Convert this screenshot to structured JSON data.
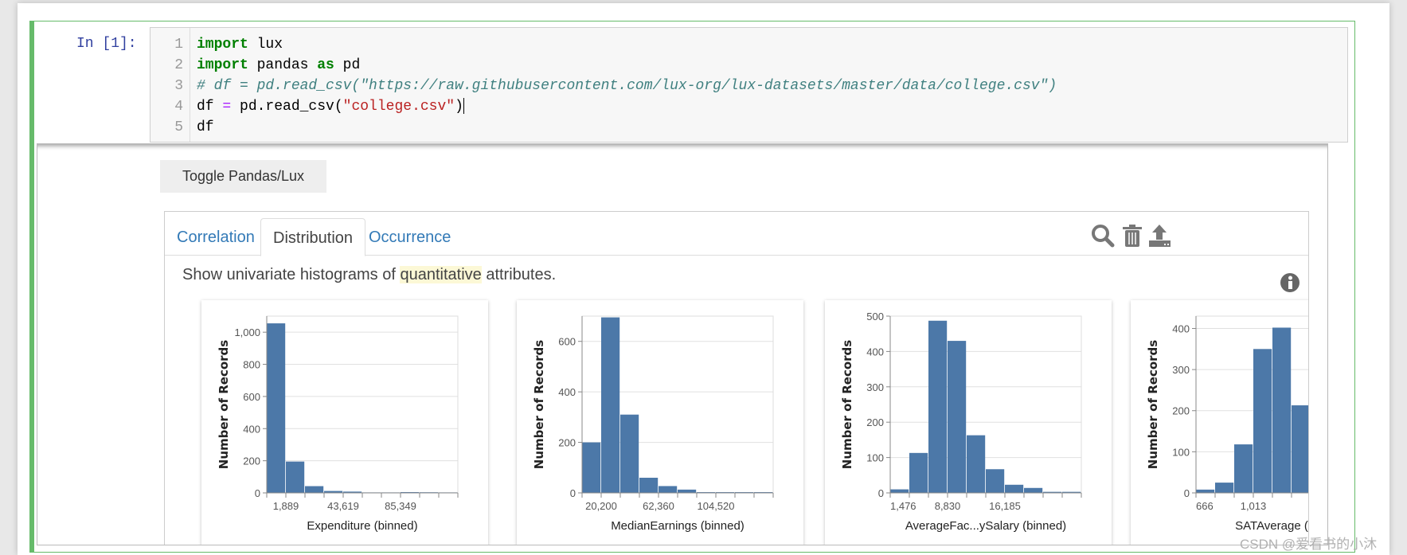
{
  "prompt": "In  [1]:",
  "code": {
    "line_numbers": [
      "1",
      "2",
      "3",
      "4",
      "5"
    ],
    "line1": {
      "kw": "import",
      "rest": " lux"
    },
    "line2": {
      "kw1": "import",
      "mid": " pandas ",
      "kw2": "as",
      "rest": " pd"
    },
    "line3": "# df = pd.read_csv(\"https://raw.githubusercontent.com/lux-org/lux-datasets/master/data/college.csv\")",
    "line4": {
      "a": "df ",
      "op": "=",
      "b": " pd.read_csv(",
      "str": "\"college.csv\"",
      "c": ")"
    },
    "line5": "df"
  },
  "toggle_label": "Toggle Pandas/Lux",
  "tabs": [
    {
      "label": "Correlation",
      "active": false
    },
    {
      "label": "Distribution",
      "active": true
    },
    {
      "label": "Occurrence",
      "active": false
    }
  ],
  "toolbar_icons": [
    "search-icon",
    "trash-icon",
    "export-icon"
  ],
  "description": {
    "before": "Show univariate histograms of ",
    "highlight": "quantitative",
    "after": " attributes."
  },
  "colors": {
    "bar": "#4c78a8",
    "accent_green": "#66bb6a",
    "link": "#337ab7"
  },
  "chart_data": [
    {
      "type": "bar",
      "xlabel": "Expenditure (binned)",
      "ylabel": "Number of Records",
      "values": [
        1055,
        195,
        42,
        12,
        8,
        3,
        3,
        5,
        4,
        3
      ],
      "ylim": [
        0,
        1100
      ],
      "yticks": [
        "0",
        "200",
        "400",
        "600",
        "800",
        "1,000"
      ],
      "ytick_values": [
        0,
        200,
        400,
        600,
        800,
        1000
      ],
      "xtick_labels": [
        {
          "edge": 1,
          "label": "1,889"
        },
        {
          "edge": 4,
          "label": "43,619"
        },
        {
          "edge": 7,
          "label": "85,349"
        }
      ],
      "grid": true
    },
    {
      "type": "bar",
      "xlabel": "MedianEarnings (binned)",
      "ylabel": "Number of Records",
      "values": [
        200,
        695,
        310,
        60,
        27,
        13,
        3,
        3,
        3,
        3
      ],
      "ylim": [
        0,
        700
      ],
      "yticks": [
        "0",
        "200",
        "400",
        "600"
      ],
      "ytick_values": [
        0,
        200,
        400,
        600
      ],
      "xtick_labels": [
        {
          "edge": 1,
          "label": "20,200"
        },
        {
          "edge": 4,
          "label": "62,360"
        },
        {
          "edge": 7,
          "label": "104,520"
        }
      ],
      "grid": true
    },
    {
      "type": "bar",
      "xlabel": "AverageFac...ySalary (binned)",
      "ylabel": "Number of Records",
      "values": [
        10,
        113,
        487,
        430,
        163,
        67,
        23,
        14,
        3,
        3
      ],
      "ylim": [
        0,
        500
      ],
      "yticks": [
        "0",
        "100",
        "200",
        "300",
        "400",
        "500"
      ],
      "ytick_values": [
        0,
        100,
        200,
        300,
        400,
        500
      ],
      "xtick_labels": [
        {
          "edge": 0,
          "label": "1,476"
        },
        {
          "edge": 3,
          "label": "8,830"
        },
        {
          "edge": 6,
          "label": "16,185"
        }
      ],
      "grid": true
    },
    {
      "type": "bar",
      "xlabel": "SATAverage (binned)",
      "ylabel": "Number of Records",
      "values": [
        8,
        25,
        118,
        350,
        402,
        213
      ],
      "ylim": [
        0,
        430
      ],
      "yticks": [
        "0",
        "100",
        "200",
        "300",
        "400"
      ],
      "ytick_values": [
        0,
        100,
        200,
        300,
        400
      ],
      "xtick_labels": [
        {
          "edge": 0,
          "label": "666"
        },
        {
          "edge": 3,
          "label": "1,013"
        }
      ],
      "grid": true
    }
  ],
  "watermark": "CSDN @爱看书的小沐"
}
